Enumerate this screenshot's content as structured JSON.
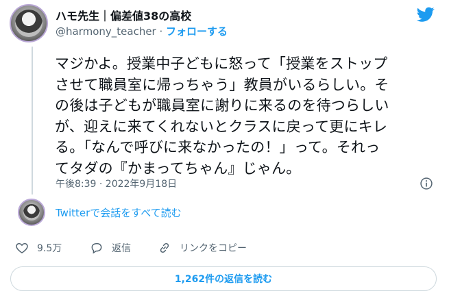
{
  "author": {
    "display_name": "ハモ先生｜偏差値38の高校",
    "handle": "@harmony_teacher",
    "separator": " · ",
    "follow_label": "フォローする"
  },
  "tweet": {
    "lines": [
      "マジかよ。授業中子どもに怒って「授業をストップ",
      "させて職員室に帰っちゃう」教員がいるらしい。そ",
      "の後は子どもが職員室に謝りに来るのを待つらしい",
      "が、迎えに来てくれないとクラスに戻って更にキレ",
      "る。「なんで呼びに来なかったの！」って。それっ",
      "てタダの『かまってちゃん』じゃん。"
    ],
    "timestamp": "午後8:39 · 2022年9月18日"
  },
  "thread": {
    "read_all_label": "Twitterで会話をすべて読む"
  },
  "actions": {
    "likes_count": "9.5万",
    "reply_label": "返信",
    "copy_link_label": "リンクをコピー"
  },
  "replies_button_label": "1,262件の返信を読む",
  "icons": {
    "logo": "twitter-bird-icon",
    "info": "info-icon",
    "like": "heart-icon",
    "reply": "speech-bubble-icon",
    "copy": "link-icon"
  },
  "colors": {
    "accent": "#1d9bf0",
    "secondary_text": "#536471",
    "primary_text": "#0f1419",
    "border": "#cfd9de"
  }
}
